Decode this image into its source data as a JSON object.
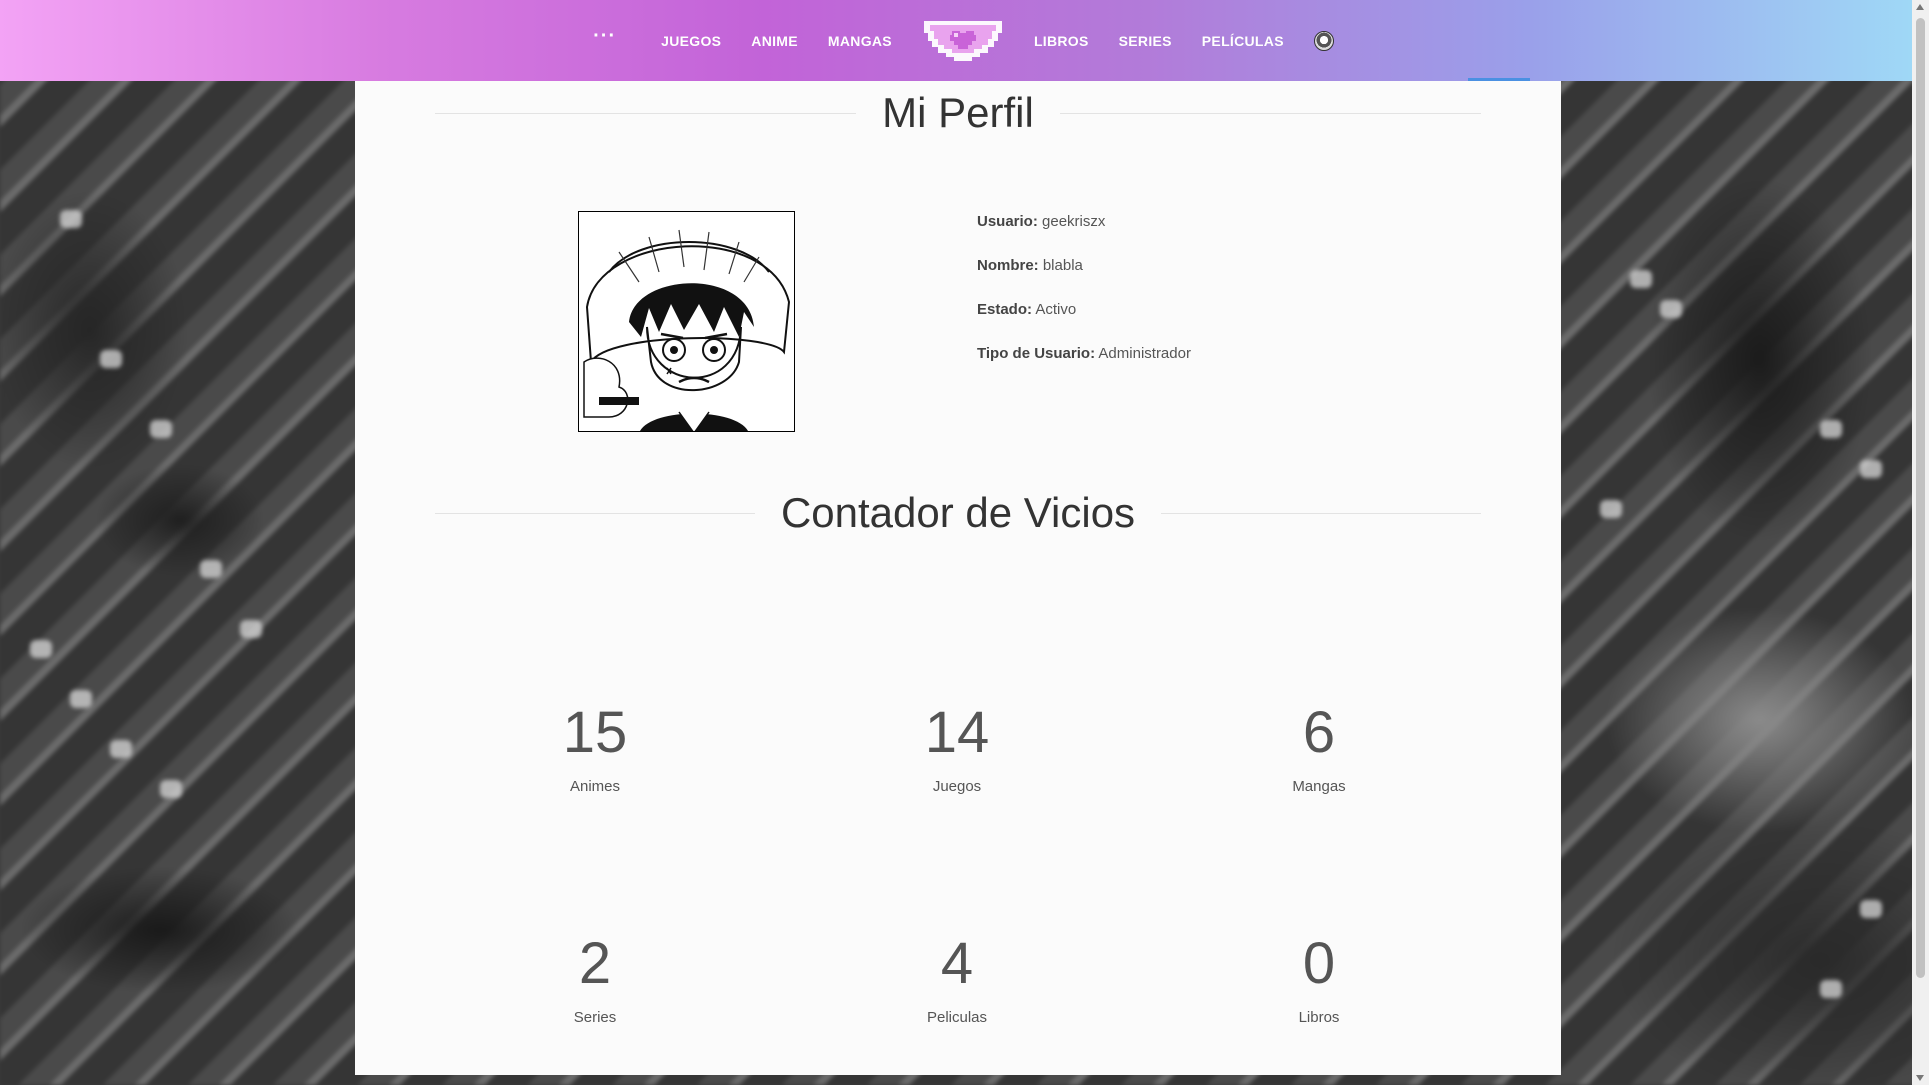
{
  "nav": {
    "more": "···",
    "items_left": [
      "JUEGOS",
      "ANIME",
      "MANGAS"
    ],
    "items_right": [
      "LIBROS",
      "SERIES",
      "PELÍCULAS"
    ]
  },
  "profile": {
    "title": "Mi Perfil",
    "fields": [
      {
        "label": "Usuario:",
        "value": "geekriszx"
      },
      {
        "label": "Nombre:",
        "value": "blabla"
      },
      {
        "label": "Estado:",
        "value": "Activo"
      },
      {
        "label": "Tipo de Usuario:",
        "value": "Administrador"
      }
    ]
  },
  "counter": {
    "title": "Contador de Vicios",
    "stats": [
      {
        "value": "15",
        "label": "Animes"
      },
      {
        "value": "14",
        "label": "Juegos"
      },
      {
        "value": "6",
        "label": "Mangas"
      },
      {
        "value": "2",
        "label": "Series"
      },
      {
        "value": "4",
        "label": "Peliculas"
      },
      {
        "value": "0",
        "label": "Libros"
      }
    ]
  },
  "colors": {
    "nav_gradient_start": "#f3a3f5",
    "nav_gradient_mid": "#c263d8",
    "nav_gradient_end": "#9fd8f6",
    "accent_tab": "#4a90e2"
  }
}
